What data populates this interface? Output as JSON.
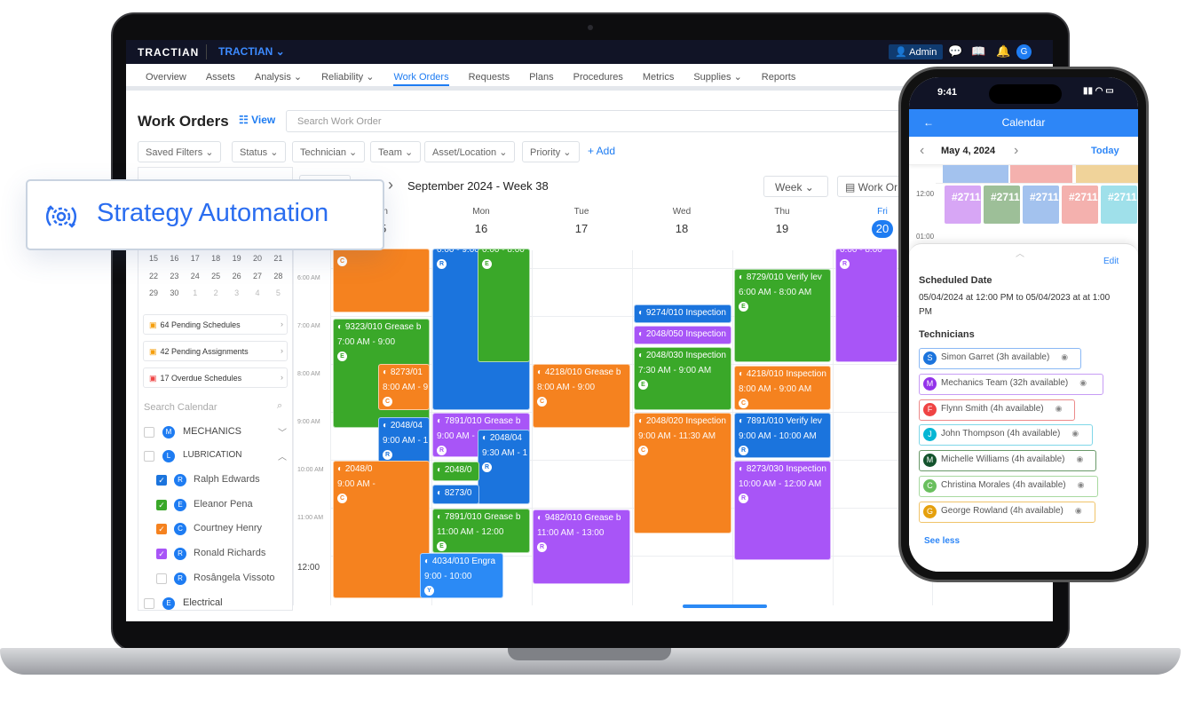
{
  "app": {
    "logo": "TRACTIAN",
    "org": "TRACTIAN ⌄",
    "admin": "Admin",
    "avatar": "G"
  },
  "nav": [
    "Overview",
    "Assets",
    "Analysis ⌄",
    "Reliability ⌄",
    "Work Orders",
    "Requests",
    "Plans",
    "Procedures",
    "Metrics",
    "Supplies ⌄",
    "Reports"
  ],
  "nav_active": "Work Orders",
  "page": {
    "title": "Work Orders",
    "view_label": "View",
    "search_placeholder": "Search Work Order"
  },
  "filters": [
    "Saved Filters ⌄",
    "Status ⌄",
    "Technician ⌄",
    "Team ⌄",
    "Asset/Location ⌄",
    "Priority ⌄"
  ],
  "add_label": "+ Add",
  "calendar": {
    "title": "September 2024 - Week 38",
    "view_select": "Week ⌄",
    "work_orders_btn": "Work Or",
    "days": [
      {
        "name": "Sun",
        "num": "15"
      },
      {
        "name": "Mon",
        "num": "16"
      },
      {
        "name": "Tue",
        "num": "17"
      },
      {
        "name": "Wed",
        "num": "18"
      },
      {
        "name": "Thu",
        "num": "19"
      },
      {
        "name": "Fri",
        "num": "20"
      }
    ],
    "today": "20",
    "times": [
      "6:00 AM",
      "7:00 AM",
      "8:00 AM",
      "9:00 AM",
      "10:00 AM",
      "11:00 AM",
      "12:00"
    ],
    "events": [
      {
        "title": "",
        "time": "",
        "who": "C",
        "color": "#f5821f"
      },
      {
        "title": "9323/010 Grease b",
        "time": "7:00 AM - 9:00",
        "who": "E",
        "color": "#3aa829"
      },
      {
        "title": "8273/01",
        "time": "8:00 AM - 9",
        "who": "C",
        "color": "#f5821f"
      },
      {
        "title": "2048/04",
        "time": "9:00 AM - 1",
        "who": "R",
        "color": "#1b74dd"
      },
      {
        "title": "2048/0",
        "time": "9:00 AM -",
        "who": "C",
        "color": "#f5821f"
      },
      {
        "title": "",
        "time": "0:00 - 9:00",
        "who": "R",
        "color": "#1b74dd"
      },
      {
        "title": "",
        "time": "0:00 - 8:00",
        "who": "E",
        "color": "#3aa829"
      },
      {
        "title": "7891/010 Grease b",
        "time": "9:00 AM -",
        "who": "R",
        "color": "#a855f7"
      },
      {
        "title": "2048/04",
        "time": "9:30 AM - 1",
        "who": "R",
        "color": "#1b74dd"
      },
      {
        "title": "2048/0",
        "time": "",
        "who": "",
        "color": "#3aa829"
      },
      {
        "title": "8273/0",
        "time": "",
        "who": "",
        "color": "#1b74dd"
      },
      {
        "title": "7891/010 Grease b",
        "time": "11:00 AM - 12:00",
        "who": "E",
        "color": "#3aa829"
      },
      {
        "title": "4034/010 Engra",
        "time": "9:00 - 10:00",
        "who": "Y",
        "color": "#2b8af5"
      },
      {
        "title": "4218/010 Grease b",
        "time": "8:00 AM - 9:00",
        "who": "C",
        "color": "#f5821f"
      },
      {
        "title": "9482/010 Grease b",
        "time": "11:00 AM - 13:00",
        "who": "R",
        "color": "#a855f7"
      },
      {
        "title": "9274/010 Inspection",
        "time": "",
        "who": "",
        "color": "#1b74dd"
      },
      {
        "title": "2048/050 Inspection",
        "time": "",
        "who": "",
        "color": "#a855f7"
      },
      {
        "title": "2048/030 Inspection",
        "time": "7:30 AM - 9:00 AM",
        "who": "E",
        "color": "#3aa829"
      },
      {
        "title": "2048/020 Inspection",
        "time": "9:00 AM - 11:30 AM",
        "who": "C",
        "color": "#f5821f"
      },
      {
        "title": "8729/010 Verify lev",
        "time": "6:00 AM - 8:00 AM",
        "who": "E",
        "color": "#3aa829"
      },
      {
        "title": "4218/010 Inspection",
        "time": "8:00 AM - 9:00 AM",
        "who": "C",
        "color": "#f5821f"
      },
      {
        "title": "7891/010 Verify lev",
        "time": "9:00 AM - 10:00 AM",
        "who": "R",
        "color": "#1b74dd"
      },
      {
        "title": "8273/030 Inspection",
        "time": "10:00 AM - 12:00 AM",
        "who": "R",
        "color": "#a855f7"
      },
      {
        "title": "",
        "time": "0:00 - 8:00",
        "who": "R",
        "color": "#a855f7"
      }
    ]
  },
  "sidebar": {
    "mini_rows": [
      [
        "15",
        "16",
        "17",
        "18",
        "19",
        "20",
        "21"
      ],
      [
        "22",
        "23",
        "24",
        "25",
        "26",
        "27",
        "28"
      ],
      [
        "29",
        "30",
        "1",
        "2",
        "3",
        "4",
        "5"
      ]
    ],
    "cards": [
      {
        "label": "64 Pending Schedules",
        "icon": "calendar-clock-icon",
        "color": "#f59e0b"
      },
      {
        "label": "42 Pending Assignments",
        "icon": "user-alert-icon",
        "color": "#f59e0b"
      },
      {
        "label": "17 Overdue Schedules",
        "icon": "calendar-alert-icon",
        "color": "#ef4444"
      }
    ],
    "search_placeholder": "Search Calendar",
    "groups": [
      {
        "initial": "M",
        "label": "MECHANICS",
        "checked": false
      },
      {
        "initial": "L",
        "label": "LUBRICATION",
        "checked": false
      }
    ],
    "people": [
      {
        "initial": "R",
        "name": "Ralph Edwards",
        "color": "#1b74dd",
        "checked": true
      },
      {
        "initial": "E",
        "name": "Eleanor Pena",
        "color": "#3aa829",
        "checked": true
      },
      {
        "initial": "C",
        "name": "Courtney Henry",
        "color": "#f5821f",
        "checked": true
      },
      {
        "initial": "R",
        "name": "Ronald Richards",
        "color": "#a855f7",
        "checked": true
      },
      {
        "initial": "R",
        "name": "Rosângela Vissoto",
        "color": "#ccc",
        "checked": false
      }
    ],
    "group_electrical": {
      "initial": "E",
      "label": "Electrical"
    }
  },
  "callout": {
    "label": "Strategy Automation",
    "icon": "gear-cycle-icon"
  },
  "phone": {
    "time": "9:41",
    "header": "Calendar",
    "date": "May 4, 2024",
    "today": "Today",
    "times": [
      "12:00",
      "01:00"
    ],
    "blocks": [
      {
        "label": "#2711",
        "color": "#d7a6f5"
      },
      {
        "label": "#2711",
        "color": "#9dbf98"
      },
      {
        "label": "#2711",
        "color": "#a3c2ee"
      },
      {
        "label": "#2711",
        "color": "#f4b1ae"
      },
      {
        "label": "#2711",
        "color": "#9fe0ea"
      }
    ],
    "top_blocks": [
      "#a3c2ee",
      "#f4b1ae",
      "#f0d39a"
    ],
    "edit": "Edit",
    "sched_title": "Scheduled Date",
    "sched_text": "05/04/2024 at 12:00 PM to 05/04/2023 at at 1:00 PM",
    "tech_title": "Technicians",
    "techs": [
      {
        "initial": "S",
        "label": "Simon Garret (3h available)",
        "color": "#1b74dd",
        "border": "#8ab8f5"
      },
      {
        "initial": "M",
        "label": "Mechanics Team (32h available)",
        "color": "#9333ea",
        "border": "#c79cf5"
      },
      {
        "initial": "F",
        "label": "Flynn Smith (4h available)",
        "color": "#ef4444",
        "border": "#ec8a8a"
      },
      {
        "initial": "J",
        "label": "John Thompson (4h available)",
        "color": "#06b6d4",
        "border": "#7fd7e8"
      },
      {
        "initial": "M",
        "label": "Michelle Williams (4h available)",
        "color": "#14532d",
        "border": "#6a9a6a"
      },
      {
        "initial": "C",
        "label": "Christina Morales (4h available)",
        "color": "#6abf5e",
        "border": "#a8d9a0"
      },
      {
        "initial": "G",
        "label": "George Rowland (4h available)",
        "color": "#e5a00d",
        "border": "#f0c46a"
      }
    ],
    "see_less": "See less"
  }
}
